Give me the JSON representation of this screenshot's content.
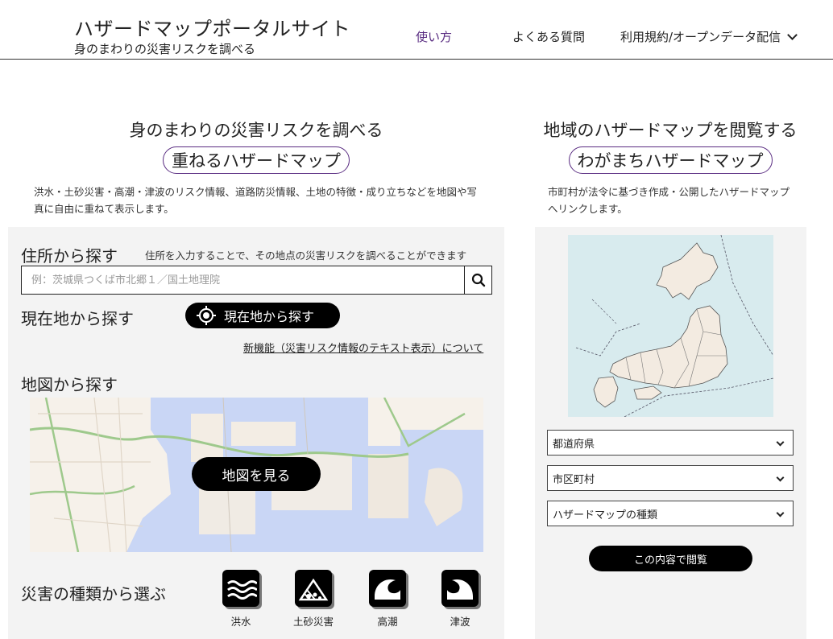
{
  "header": {
    "title": "ハザードマップポータルサイト",
    "subtitle": "身のまわりの災害リスクを調べる",
    "nav": {
      "usage": "使い方",
      "faq": "よくある質問",
      "terms": "利用規約/オープンデータ配信"
    }
  },
  "left": {
    "heading": "身のまわりの災害リスクを調べる",
    "pill": "重ねるハザードマップ",
    "description": "洪水・土砂災害・高潮・津波のリスク情報、道路防災情報、土地の特徴・成り立ちなどを地図や写真に自由に重ねて表示します。",
    "address": {
      "heading": "住所から探す",
      "note": "住所を入力することで、その地点の災害リスクを調べることができます",
      "placeholder": "例：茨城県つくば市北郷１／国土地理院"
    },
    "current": {
      "heading": "現在地から探す",
      "button": "現在地から探す"
    },
    "new_feature_link": "新機能（災害リスク情報のテキスト表示）について",
    "map_search": {
      "heading": "地図から探す",
      "button": "地図を見る"
    },
    "disaster": {
      "heading": "災害の種類から選ぶ",
      "items": [
        "洪水",
        "土砂災害",
        "高潮",
        "津波"
      ]
    }
  },
  "right": {
    "heading": "地域のハザードマップを閲覧する",
    "pill": "わがまちハザードマップ",
    "description": "市町村が法令に基づき作成・公開したハザードマップへリンクします。",
    "selects": {
      "prefecture": "都道府県",
      "city": "市区町村",
      "map_type": "ハザードマップの種類"
    },
    "browse_button": "この内容で閲覧"
  },
  "colors": {
    "accent": "#5a2d82",
    "button": "#000000",
    "panel_bg": "#f3f3f3",
    "japan_sea": "#d8ebee",
    "land": "#f3ebe1"
  },
  "icons": {
    "search": "search-icon",
    "location": "location-target-icon",
    "flood": "flood-icon",
    "landslide": "landslide-icon",
    "storm_surge": "storm-surge-icon",
    "tsunami": "tsunami-icon"
  }
}
